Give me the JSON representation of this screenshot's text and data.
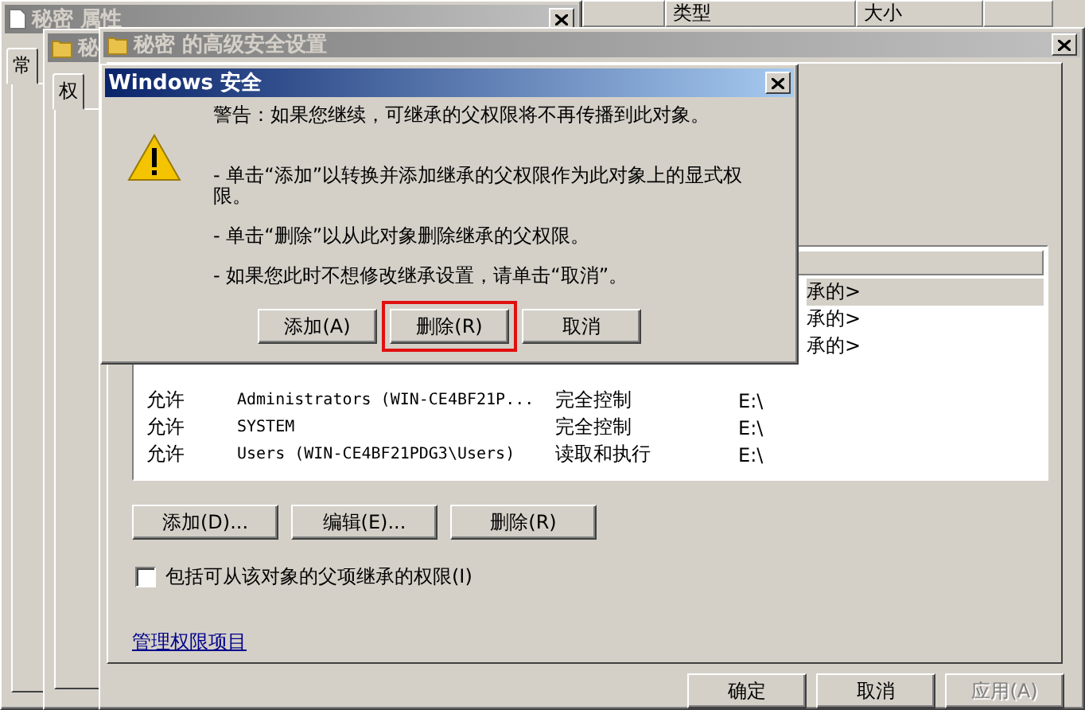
{
  "explorer_window": {
    "columns": [
      "类型",
      "大小"
    ]
  },
  "properties_window": {
    "title": "秘密 属性",
    "active": false,
    "tabs": [
      {
        "label": "常",
        "selected": true
      }
    ]
  },
  "advanced_window_behind": {
    "title": "秘",
    "active": false,
    "tabs": [
      {
        "label": "权",
        "selected": true
      }
    ]
  },
  "advanced_window": {
    "title": "秘密 的高级安全设置",
    "active": false,
    "permission_list": {
      "partial_rows": [
        {
          "inherited_from": "承的>",
          "selected": true
        },
        {
          "inherited_from": "承的>",
          "selected": false
        },
        {
          "inherited_from": "承的>",
          "selected": false
        }
      ],
      "entries": [
        {
          "type": "允许",
          "principal": "Administrators (WIN-CE4BF21P...",
          "access": "完全控制",
          "inherited_from": "E:\\"
        },
        {
          "type": "允许",
          "principal": "SYSTEM",
          "access": "完全控制",
          "inherited_from": "E:\\"
        },
        {
          "type": "允许",
          "principal": "Users (WIN-CE4BF21PDG3\\Users)",
          "access": "读取和执行",
          "inherited_from": "E:\\"
        }
      ]
    },
    "list_buttons": [
      "添加(D)...",
      "编辑(E)...",
      "删除(R)"
    ],
    "inherit_checkbox": {
      "label": "包括可从该对象的父项继承的权限(I)",
      "checked": false
    },
    "link": "管理权限项目",
    "footer_buttons": [
      {
        "label": "确定",
        "disabled": false
      },
      {
        "label": "取消",
        "disabled": false
      },
      {
        "label": "应用(A)",
        "disabled": true
      }
    ]
  },
  "security_dialog": {
    "title": "Windows 安全",
    "active": true,
    "warning": "警告：如果您继续，可继承的父权限将不再传播到此对象。",
    "bullets": [
      "- 单击“添加”以转换并添加继承的父权限作为此对象上的显式权限。",
      "- 单击“删除”以从此对象删除继承的父权限。",
      "- 如果您此时不想修改继承设置，请单击“取消”。"
    ],
    "buttons": [
      {
        "label": "添加(A)",
        "highlighted": false
      },
      {
        "label": "删除(R)",
        "highlighted": true
      },
      {
        "label": "取消",
        "highlighted": false
      }
    ]
  }
}
